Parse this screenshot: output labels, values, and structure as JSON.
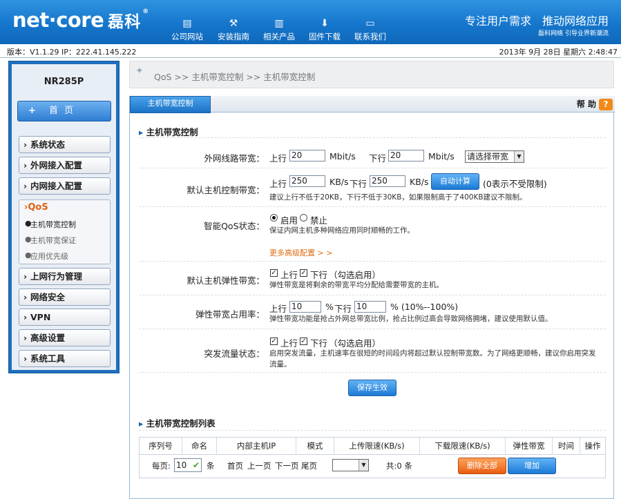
{
  "header": {
    "logo": "net·core",
    "logo_cn": "磊科",
    "logo_reg": "®",
    "nav": [
      {
        "label": "公司网站",
        "icon": "monitor-icon"
      },
      {
        "label": "安装指南",
        "icon": "tools-icon"
      },
      {
        "label": "相关产品",
        "icon": "router-icon"
      },
      {
        "label": "固件下载",
        "icon": "download-icon"
      },
      {
        "label": "联系我们",
        "icon": "chat-icon"
      }
    ],
    "slogan": "专注用户需求　推动网络应用",
    "slogan_sub": "磊科网络 引导业界新潮流"
  },
  "info": {
    "version": "版本：V1.1.29  IP：222.41.145.222",
    "datetime": "2013年 9月 28日 星期六 2:48:47"
  },
  "sidebar": {
    "model": "NR285P",
    "home_plus": "+",
    "home": "首页",
    "items": [
      "系统状态",
      "外网接入配置",
      "内网接入配置"
    ],
    "qos_title": "›QoS",
    "qos_subs": [
      "主机带宽控制",
      "主机带宽保证",
      "应用优先级"
    ],
    "items_after": [
      "上网行为管理",
      "网络安全",
      "VPN",
      "高级设置",
      "系统工具"
    ]
  },
  "breadcrumb": "QoS  >>  主机带宽控制  >>  主机带宽控制",
  "panel": {
    "tab": "主机带宽控制",
    "help": "帮 助",
    "help_q": "?",
    "section1": "主机带宽控制",
    "wan_bw": {
      "label": "外网线路带宽：",
      "up_label": "上行",
      "up_value": "20",
      "unit1": "Mbit/s",
      "down_label": "下行",
      "down_value": "20",
      "unit2": "Mbit/s",
      "select": "请选择带宽"
    },
    "default_bw": {
      "label": "默认主机控制带宽：",
      "up_label": "上行",
      "up_value": "250",
      "unit1": "KB/s",
      "down_label": "下行",
      "down_value": "250",
      "unit2": "KB/s",
      "auto_btn": "自动计算",
      "hint": "(0表示不受限制)",
      "note": "建议上行不低于20KB，下行不低于30KB，如果限制高于了400KB建议不限制。"
    },
    "smart_qos": {
      "label": "智能QoS状态：",
      "on": "启用",
      "off": "禁止",
      "note": "保证内网主机多种网络应用同时顺畅的工作。"
    },
    "more": "更多高级配置 > >",
    "elastic": {
      "label": "默认主机弹性带宽：",
      "up": "上行",
      "down": "下行",
      "hint": "（勾选启用）",
      "note": "弹性带宽是将剩余的带宽平均分配给需要带宽的主机。"
    },
    "ratio": {
      "label": "弹性带宽占用率：",
      "up_label": "上行",
      "up_value": "10",
      "pct1": "%",
      "down_label": "下行",
      "down_value": "10",
      "range": "% (10%--100%)",
      "note": "弹性带宽功能是抢占外网总带宽比例，抢占比例过高会导致网络拥堵，建议使用默认值。"
    },
    "burst": {
      "label": "突发流量状态：",
      "up": "上行",
      "down": "下行",
      "hint": "（勾选启用）",
      "note1": "启用突发流量，主机速率在很短的时间段内将超过默认控制带宽数。为了网络更顺畅，建议你启用突发",
      "note2": "流量。"
    },
    "save": "保存生效",
    "section2": "主机带宽控制列表",
    "table": {
      "headers": [
        "序列号",
        "命名",
        "内部主机IP",
        "模式",
        "上传限速(KB/s)",
        "下载限速(KB/s)",
        "弹性带宽",
        "时间",
        "操作"
      ],
      "per_page_label": "每页:",
      "per_page": "10",
      "per_page_unit": "条",
      "first": "首页",
      "prev": "上一页",
      "next": "下一页",
      "last": "尾页",
      "total": "共:0 条",
      "delete_all": "删除全部",
      "add": "增加"
    }
  }
}
